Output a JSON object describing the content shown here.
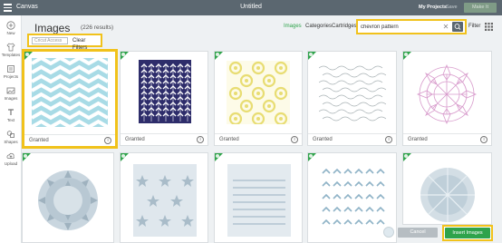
{
  "topbar": {
    "app_name": "Canvas",
    "doc_title": "Untitled",
    "my_projects": "My Projects",
    "save": "Save",
    "make_it": "Make It"
  },
  "rail": [
    {
      "label": "New",
      "icon": "plus-icon"
    },
    {
      "label": "Templates",
      "icon": "shirt-icon"
    },
    {
      "label": "Projects",
      "icon": "projects-icon"
    },
    {
      "label": "Images",
      "icon": "image-icon"
    },
    {
      "label": "Text",
      "icon": "text-icon"
    },
    {
      "label": "Shapes",
      "icon": "shapes-icon"
    },
    {
      "label": "Upload",
      "icon": "upload-icon"
    }
  ],
  "header": {
    "title": "Images",
    "count": "(226 results)",
    "tabs": [
      "Images",
      "Categories",
      "Cartridges"
    ],
    "filter": "Filter"
  },
  "search": {
    "value": "chevron pattern",
    "placeholder": "Search"
  },
  "chips": {
    "active_filter": "Cricut Access",
    "clear": "Clear Filters"
  },
  "cards": [
    {
      "label": "Granted",
      "pattern": "chevron-light-blue",
      "selected": true
    },
    {
      "label": "Granted",
      "pattern": "herringbone-navy"
    },
    {
      "label": "Granted",
      "pattern": "circles-yellow"
    },
    {
      "label": "Granted",
      "pattern": "waves-gray"
    },
    {
      "label": "Granted",
      "pattern": "burst-pink"
    },
    {
      "label": "",
      "pattern": "dome-3d"
    },
    {
      "label": "",
      "pattern": "stars-3d"
    },
    {
      "label": "",
      "pattern": "lines-3d"
    },
    {
      "label": "",
      "pattern": "chevron-small-blue"
    },
    {
      "label": "",
      "pattern": "sphere-3d"
    }
  ],
  "footer": {
    "cancel": "Cancel",
    "insert": "Insert Images"
  },
  "colors": {
    "accent": "#2fa34b",
    "highlight": "#f1c21b",
    "topbar": "#5b6770"
  }
}
